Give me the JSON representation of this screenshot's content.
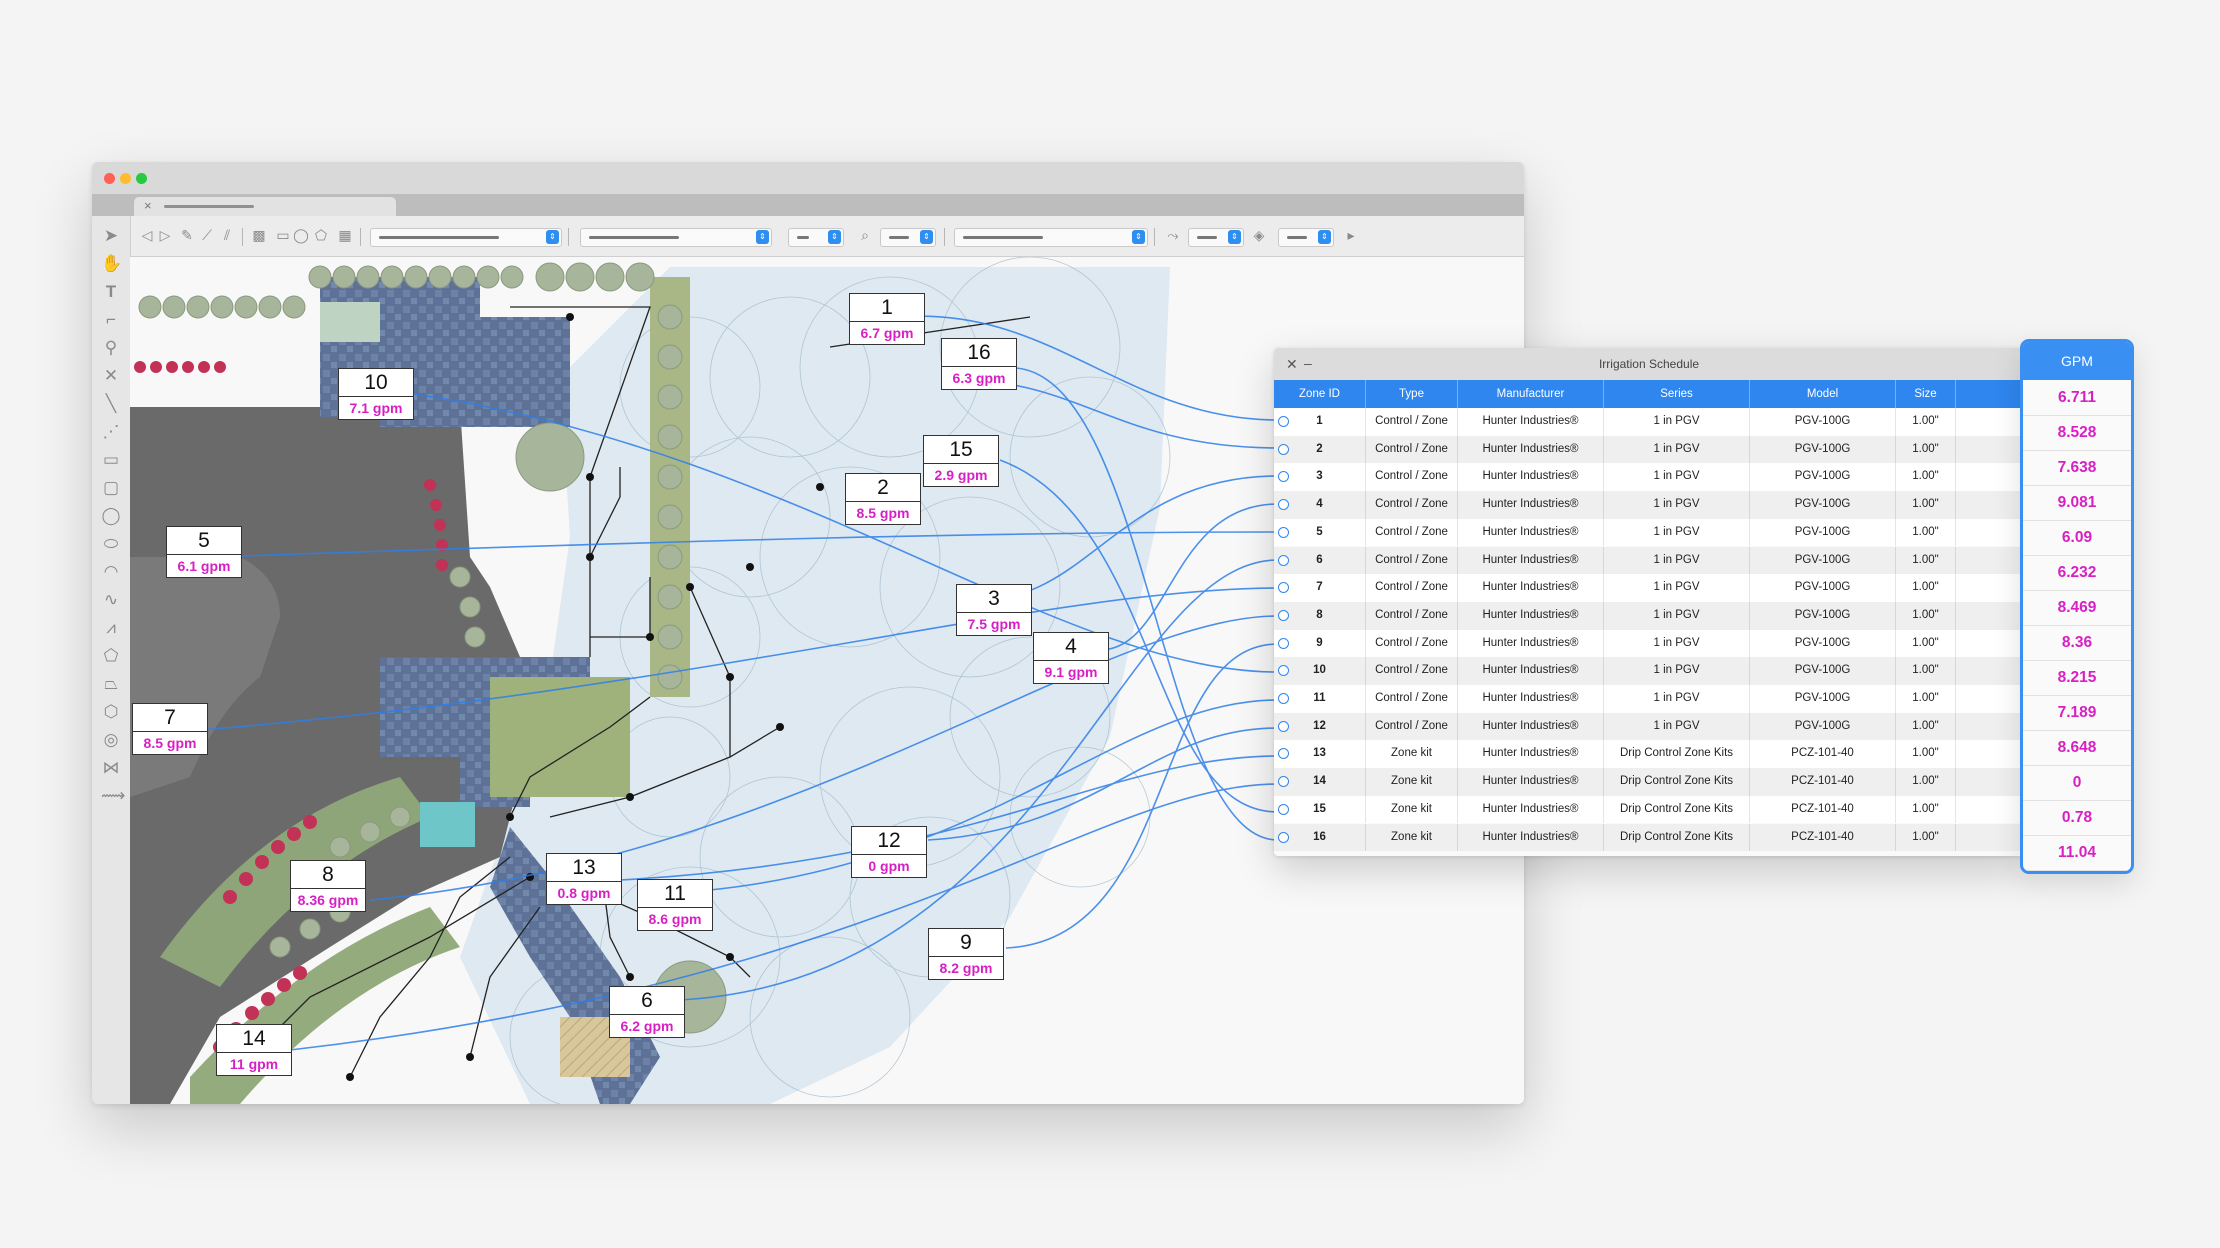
{
  "app": {
    "colors": {
      "accent": "#2f86ef",
      "gpm_text": "#d81fc4"
    }
  },
  "toolbar_icons": [
    "back-icon",
    "forward-icon",
    "pencil-icon",
    "magnify-icon"
  ],
  "callouts": [
    {
      "zone": "1",
      "gpm": "6.7 gpm"
    },
    {
      "zone": "16",
      "gpm": "6.3 gpm"
    },
    {
      "zone": "10",
      "gpm": "7.1 gpm"
    },
    {
      "zone": "15",
      "gpm": "2.9 gpm"
    },
    {
      "zone": "2",
      "gpm": "8.5 gpm"
    },
    {
      "zone": "5",
      "gpm": "6.1 gpm"
    },
    {
      "zone": "3",
      "gpm": "7.5 gpm"
    },
    {
      "zone": "4",
      "gpm": "9.1 gpm"
    },
    {
      "zone": "7",
      "gpm": "8.5 gpm"
    },
    {
      "zone": "12",
      "gpm": "0 gpm"
    },
    {
      "zone": "8",
      "gpm": "8.36 gpm"
    },
    {
      "zone": "13",
      "gpm": "0.8 gpm"
    },
    {
      "zone": "11",
      "gpm": "8.6 gpm"
    },
    {
      "zone": "9",
      "gpm": "8.2 gpm"
    },
    {
      "zone": "6",
      "gpm": "6.2 gpm"
    },
    {
      "zone": "14",
      "gpm": "11 gpm"
    }
  ],
  "schedule": {
    "title": "Irrigation Schedule",
    "columns": [
      "Zone ID",
      "Type",
      "Manufacturer",
      "Series",
      "Model",
      "Size"
    ],
    "rows": [
      [
        "1",
        "Control / Zone",
        "Hunter Industries®",
        "1 in PGV",
        "PGV-100G",
        "1.00\""
      ],
      [
        "2",
        "Control / Zone",
        "Hunter Industries®",
        "1 in PGV",
        "PGV-100G",
        "1.00\""
      ],
      [
        "3",
        "Control / Zone",
        "Hunter Industries®",
        "1 in PGV",
        "PGV-100G",
        "1.00\""
      ],
      [
        "4",
        "Control / Zone",
        "Hunter Industries®",
        "1 in PGV",
        "PGV-100G",
        "1.00\""
      ],
      [
        "5",
        "Control / Zone",
        "Hunter Industries®",
        "1 in PGV",
        "PGV-100G",
        "1.00\""
      ],
      [
        "6",
        "Control / Zone",
        "Hunter Industries®",
        "1 in PGV",
        "PGV-100G",
        "1.00\""
      ],
      [
        "7",
        "Control / Zone",
        "Hunter Industries®",
        "1 in PGV",
        "PGV-100G",
        "1.00\""
      ],
      [
        "8",
        "Control / Zone",
        "Hunter Industries®",
        "1 in PGV",
        "PGV-100G",
        "1.00\""
      ],
      [
        "9",
        "Control / Zone",
        "Hunter Industries®",
        "1 in PGV",
        "PGV-100G",
        "1.00\""
      ],
      [
        "10",
        "Control / Zone",
        "Hunter Industries®",
        "1 in PGV",
        "PGV-100G",
        "1.00\""
      ],
      [
        "11",
        "Control / Zone",
        "Hunter Industries®",
        "1 in PGV",
        "PGV-100G",
        "1.00\""
      ],
      [
        "12",
        "Control / Zone",
        "Hunter Industries®",
        "1 in PGV",
        "PGV-100G",
        "1.00\""
      ],
      [
        "13",
        "Zone kit",
        "Hunter Industries®",
        "Drip Control Zone Kits",
        "PCZ-101-40",
        "1.00\""
      ],
      [
        "14",
        "Zone kit",
        "Hunter Industries®",
        "Drip Control Zone Kits",
        "PCZ-101-40",
        "1.00\""
      ],
      [
        "15",
        "Zone kit",
        "Hunter Industries®",
        "Drip Control Zone Kits",
        "PCZ-101-40",
        "1.00\""
      ],
      [
        "16",
        "Zone kit",
        "Hunter Industries®",
        "Drip Control Zone Kits",
        "PCZ-101-40",
        "1.00\""
      ]
    ]
  },
  "gpm_panel": {
    "header": "GPM",
    "values": [
      "6.711",
      "8.528",
      "7.638",
      "9.081",
      "6.09",
      "6.232",
      "8.469",
      "8.36",
      "8.215",
      "7.189",
      "8.648",
      "0",
      "0.78",
      "11.04"
    ]
  }
}
